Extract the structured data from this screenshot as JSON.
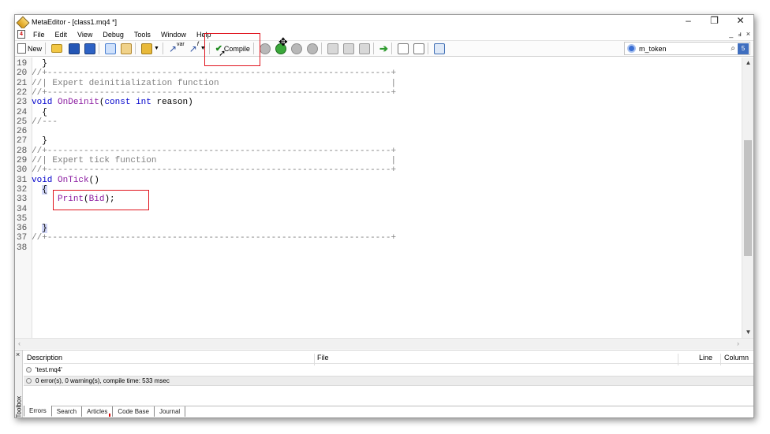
{
  "window": {
    "title": "MetaEditor - [class1.mq4 *]"
  },
  "window_controls": {
    "minimize": "–",
    "restore": "❐",
    "close": "✕"
  },
  "menu": {
    "items": [
      "File",
      "Edit",
      "View",
      "Debug",
      "Tools",
      "Window",
      "Help"
    ],
    "mdi_controls": [
      "_",
      "ⅎ",
      "×"
    ]
  },
  "toolbar": {
    "new_label": "New",
    "compile_label": "Compile",
    "var_label": "var",
    "f_label": "f",
    "search_value": "m_token"
  },
  "editor": {
    "lines": [
      {
        "num": "19",
        "code": "  }"
      },
      {
        "num": "20",
        "code": "//+------------------------------------------------------------------+"
      },
      {
        "num": "21",
        "code": "//| Expert deinitialization function                                 |"
      },
      {
        "num": "22",
        "code": "//+------------------------------------------------------------------+"
      },
      {
        "num": "23",
        "code": "void OnDeinit(const int reason)"
      },
      {
        "num": "24",
        "code": "  {"
      },
      {
        "num": "25",
        "code": "//---"
      },
      {
        "num": "26",
        "code": ""
      },
      {
        "num": "27",
        "code": "  }"
      },
      {
        "num": "28",
        "code": "//+------------------------------------------------------------------+"
      },
      {
        "num": "29",
        "code": "//| Expert tick function                                             |"
      },
      {
        "num": "30",
        "code": "//+------------------------------------------------------------------+"
      },
      {
        "num": "31",
        "code": "void OnTick()"
      },
      {
        "num": "32",
        "code": "  {"
      },
      {
        "num": "33",
        "code": "     Print(Bid);"
      },
      {
        "num": "34",
        "code": ""
      },
      {
        "num": "35",
        "code": ""
      },
      {
        "num": "36",
        "code": "  }"
      },
      {
        "num": "37",
        "code": "//+------------------------------------------------------------------+"
      },
      {
        "num": "38",
        "code": ""
      }
    ]
  },
  "toolbox": {
    "label": "Toolbox",
    "columns": {
      "description": "Description",
      "file": "File",
      "line": "Line",
      "column": "Column"
    },
    "rows": [
      {
        "text": "'test.mq4'"
      },
      {
        "text": "0 error(s), 0 warning(s), compile time: 533 msec"
      }
    ],
    "tabs": [
      "Errors",
      "Search",
      "Articles",
      "Code Base",
      "Journal"
    ]
  },
  "colors": {
    "highlight": "#e0141e",
    "keyword": "#0000cc",
    "function": "#8a1aa0",
    "comment": "#808080"
  }
}
